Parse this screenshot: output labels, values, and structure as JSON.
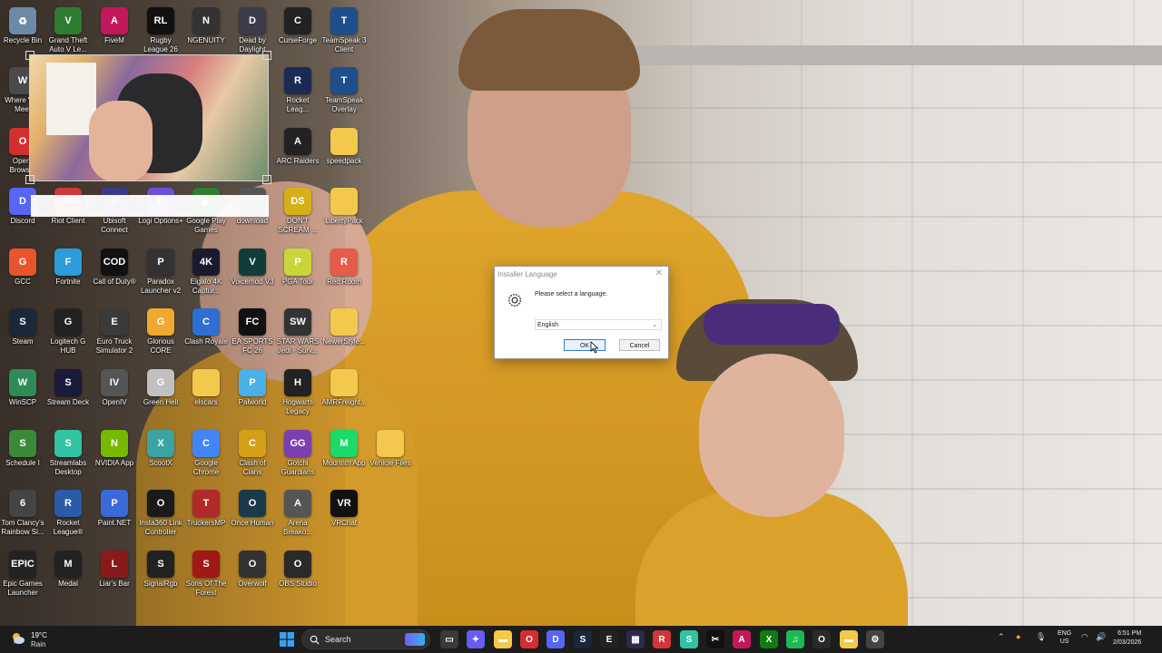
{
  "desktop": {
    "icons": [
      {
        "label": "Recycle Bin",
        "color": "#6c8aa8",
        "glyph": "♻"
      },
      {
        "label": "Grand Theft Auto V Le...",
        "color": "#2e7d32",
        "glyph": "V"
      },
      {
        "label": "FiveM",
        "color": "#c2185b",
        "glyph": "A"
      },
      {
        "label": "Rugby League 26",
        "color": "#111111",
        "glyph": "RL"
      },
      {
        "label": "NGENUITY",
        "color": "#333333",
        "glyph": "N"
      },
      {
        "label": "Dead by Daylight",
        "color": "#3b3b4a",
        "glyph": "D"
      },
      {
        "label": "CurseForge",
        "color": "#222222",
        "glyph": "C"
      },
      {
        "label": "TeamSpeak 3 Client",
        "color": "#1e4f8a",
        "glyph": "T"
      },
      {
        "label": "Where W... Meet",
        "color": "#4a4a4a",
        "glyph": "W"
      },
      {
        "label": "Rocket Leag...",
        "color": "#1b2a55",
        "glyph": "R"
      },
      {
        "label": "TeamSpeak Overlay",
        "color": "#1e4f8a",
        "glyph": "T"
      },
      {
        "label": "Opera Brows...",
        "color": "#d32f2f",
        "glyph": "O"
      },
      {
        "label": "ARC Raiders",
        "color": "#222222",
        "glyph": "A"
      },
      {
        "label": "speedpack",
        "color": "#f2c94c",
        "glyph": ""
      },
      {
        "label": "Discord",
        "color": "#5865f2",
        "glyph": "D"
      },
      {
        "label": "Riot Client",
        "color": "#d13639",
        "glyph": "R"
      },
      {
        "label": "Ubisoft Connect",
        "color": "#3a3a8a",
        "glyph": "U"
      },
      {
        "label": "Logi Options+",
        "color": "#6b4fd8",
        "glyph": "L"
      },
      {
        "label": "Google Play Games",
        "color": "#2e7d32",
        "glyph": "▶"
      },
      {
        "label": "download",
        "color": "#555555",
        "glyph": "↓"
      },
      {
        "label": "DON'T SCREAM ...",
        "color": "#d6b01a",
        "glyph": "DS"
      },
      {
        "label": "LibertyPack",
        "color": "#f2c94c",
        "glyph": ""
      },
      {
        "label": "GCC",
        "color": "#e8542b",
        "glyph": "G"
      },
      {
        "label": "Fortnite",
        "color": "#2d9cdb",
        "glyph": "F"
      },
      {
        "label": "Call of Duty®",
        "color": "#111111",
        "glyph": "COD"
      },
      {
        "label": "Paradox Launcher v2",
        "color": "#333333",
        "glyph": "P"
      },
      {
        "label": "Elgato 4K Captur...",
        "color": "#1a1a2e",
        "glyph": "4K"
      },
      {
        "label": "Voicemod V3",
        "color": "#0f3d3a",
        "glyph": "V"
      },
      {
        "label": "PGA Tour",
        "color": "#c9d63a",
        "glyph": "P"
      },
      {
        "label": "Rec Room",
        "color": "#e65c4a",
        "glyph": "R"
      },
      {
        "label": "Steam",
        "color": "#1b2838",
        "glyph": "S"
      },
      {
        "label": "Logitech G HUB",
        "color": "#222222",
        "glyph": "G"
      },
      {
        "label": "Euro Truck Simulator 2",
        "color": "#3a3a3a",
        "glyph": "E"
      },
      {
        "label": "Glorious CORE",
        "color": "#f0a830",
        "glyph": "G"
      },
      {
        "label": "Clash Royale",
        "color": "#2f6fd1",
        "glyph": "C"
      },
      {
        "label": "EA SPORTS FC 26",
        "color": "#111111",
        "glyph": "FC"
      },
      {
        "label": "STAR WARS Jedi - Surv...",
        "color": "#333333",
        "glyph": "SW"
      },
      {
        "label": "NewerStyle...",
        "color": "#f2c94c",
        "glyph": ""
      },
      {
        "label": "WinSCP",
        "color": "#2e8b57",
        "glyph": "W"
      },
      {
        "label": "Stream Deck",
        "color": "#1a1a3a",
        "glyph": "S"
      },
      {
        "label": "OpenIV",
        "color": "#555555",
        "glyph": "IV"
      },
      {
        "label": "Green Hell",
        "color": "#c0c0c0",
        "glyph": "G"
      },
      {
        "label": "elscars",
        "color": "#f2c94c",
        "glyph": ""
      },
      {
        "label": "Palworld",
        "color": "#4ab0e8",
        "glyph": "P"
      },
      {
        "label": "Hogwarts Legacy",
        "color": "#222222",
        "glyph": "H"
      },
      {
        "label": "AMRFreight...",
        "color": "#f2c94c",
        "glyph": ""
      },
      {
        "label": "Schedule I",
        "color": "#3a8a3a",
        "glyph": "S"
      },
      {
        "label": "Streamlabs Desktop",
        "color": "#31c3a2",
        "glyph": "S"
      },
      {
        "label": "NVIDIA App",
        "color": "#76b900",
        "glyph": "N"
      },
      {
        "label": "ScootX",
        "color": "#3aa3a3",
        "glyph": "X"
      },
      {
        "label": "Google Chrome",
        "color": "#4285f4",
        "glyph": "C"
      },
      {
        "label": "Clash of Clans",
        "color": "#d4a017",
        "glyph": "C"
      },
      {
        "label": "Gotchi Guardians",
        "color": "#7b3fb0",
        "glyph": "GG"
      },
      {
        "label": "Modrinth App",
        "color": "#1bd96a",
        "glyph": "M"
      },
      {
        "label": "Vehicle Files",
        "color": "#f2c94c",
        "glyph": ""
      },
      {
        "label": "Tom Clancy's Rainbow Si...",
        "color": "#444444",
        "glyph": "6"
      },
      {
        "label": "Rocket League®",
        "color": "#2b5aa8",
        "glyph": "R"
      },
      {
        "label": "Paint.NET",
        "color": "#3a6ad8",
        "glyph": "P"
      },
      {
        "label": "Insta360 Link Controller",
        "color": "#1a1a1a",
        "glyph": "O"
      },
      {
        "label": "TruckersMP",
        "color": "#b02a2a",
        "glyph": "T"
      },
      {
        "label": "Once Human",
        "color": "#1a3a4a",
        "glyph": "O"
      },
      {
        "label": "Arena Breako...",
        "color": "#555555",
        "glyph": "A"
      },
      {
        "label": "VRChat",
        "color": "#111111",
        "glyph": "VR"
      },
      {
        "label": "Epic Games Launcher",
        "color": "#222222",
        "glyph": "EPIC"
      },
      {
        "label": "Medal",
        "color": "#222222",
        "glyph": "M"
      },
      {
        "label": "Liar's Bar",
        "color": "#8a1a1a",
        "glyph": "L"
      },
      {
        "label": "SignalRgb",
        "color": "#222222",
        "glyph": "S"
      },
      {
        "label": "Sons Of The Forest",
        "color": "#a01818",
        "glyph": "S"
      },
      {
        "label": "Overwolf",
        "color": "#333333",
        "glyph": "O"
      },
      {
        "label": "OBS Studio",
        "color": "#2a2a2a",
        "glyph": "O"
      }
    ]
  },
  "dialog": {
    "title": "Installer Language",
    "close_glyph": "✕",
    "message": "Please select a language.",
    "selected_language": "English",
    "ok_label": "OK",
    "cancel_label": "Cancel"
  },
  "taskbar": {
    "weather_temp": "19°C",
    "weather_cond": "Rain",
    "search_label": "Search",
    "discord_badge": "",
    "apps": [
      {
        "name": "task-view-icon",
        "color": "#3a3a3a",
        "glyph": "▭"
      },
      {
        "name": "copilot-icon",
        "color": "#6a5cf0",
        "glyph": "✦"
      },
      {
        "name": "file-explorer-icon",
        "color": "#f2c94c",
        "glyph": "▬"
      },
      {
        "name": "opera-icon",
        "color": "#d32f2f",
        "glyph": "O"
      },
      {
        "name": "discord-icon",
        "color": "#5865f2",
        "glyph": "D"
      },
      {
        "name": "steam-icon",
        "color": "#1b2838",
        "glyph": "S"
      },
      {
        "name": "epic-games-icon",
        "color": "#222222",
        "glyph": "E"
      },
      {
        "name": "stream-deck-icon",
        "color": "#2a2a4a",
        "glyph": "▦"
      },
      {
        "name": "riot-client-icon",
        "color": "#d13639",
        "glyph": "R"
      },
      {
        "name": "streamlabs-icon",
        "color": "#31c3a2",
        "glyph": "S"
      },
      {
        "name": "capcut-icon",
        "color": "#111111",
        "glyph": "✂"
      },
      {
        "name": "fivem-icon",
        "color": "#c2185b",
        "glyph": "A"
      },
      {
        "name": "xbox-icon",
        "color": "#107c10",
        "glyph": "X"
      },
      {
        "name": "spotify-icon",
        "color": "#1db954",
        "glyph": "♫"
      },
      {
        "name": "insta360-icon",
        "color": "#2a2a2a",
        "glyph": "O"
      },
      {
        "name": "folder-icon",
        "color": "#f2c94c",
        "glyph": "▬"
      },
      {
        "name": "installer-icon",
        "color": "#444444",
        "glyph": "⚙"
      }
    ],
    "lang_top": "ENG",
    "lang_bottom": "US",
    "time": "6:51 PM",
    "date": "2/03/2026"
  }
}
